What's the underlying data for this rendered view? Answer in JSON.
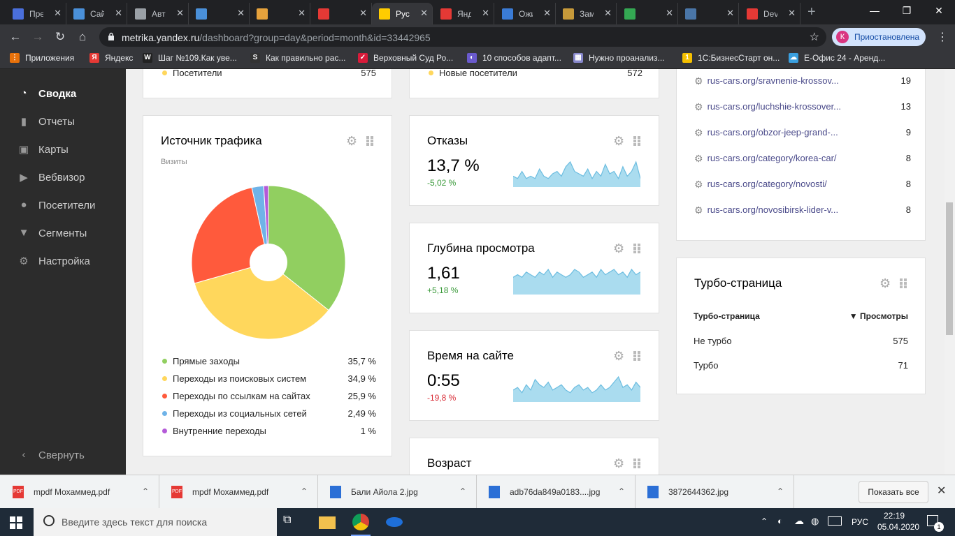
{
  "browser": {
    "tabs": [
      {
        "title": "Пре",
        "color": "#4a6fdc"
      },
      {
        "title": "Сай",
        "color": "#4a90d9"
      },
      {
        "title": "Авто",
        "color": "#9aa0a6"
      },
      {
        "title": "",
        "color": "#4a90d9"
      },
      {
        "title": "",
        "color": "#e6a23c"
      },
      {
        "title": "",
        "color": "#e53935"
      },
      {
        "title": "Рус",
        "color": "#ffcc00",
        "active": true
      },
      {
        "title": "Янд",
        "color": "#e53935"
      },
      {
        "title": "Ожи",
        "color": "#3a7bd5"
      },
      {
        "title": "Зам",
        "color": "#c79a3a"
      },
      {
        "title": "",
        "color": "#34a853"
      },
      {
        "title": "",
        "color": "#4a76a8"
      },
      {
        "title": "Dev",
        "color": "#e53935"
      }
    ],
    "url_host": "metrika.yandex.ru",
    "url_path": "/dashboard?group=day&period=month&id=33442965",
    "profile_initial": "К",
    "profile_label": "Приостановлена"
  },
  "bookmarks": [
    {
      "label": "Приложения",
      "icon": "apps-icon",
      "color": "#e8710a"
    },
    {
      "label": "Яндекс",
      "icon": "yandex-icon",
      "color": "#e53935"
    },
    {
      "label": "Шаг №109.Как уве...",
      "icon": "wp-icon",
      "color": "#222"
    },
    {
      "label": "Как правильно рас...",
      "icon": "s-icon",
      "color": "#333"
    },
    {
      "label": "Верховный Суд Ро...",
      "icon": "check-icon",
      "color": "#d81b3a"
    },
    {
      "label": "10 способов адапт...",
      "icon": "habr-icon",
      "color": "#6a5acd"
    },
    {
      "label": "Нужно проанализ...",
      "icon": "doc-icon",
      "color": "#8888cc"
    },
    {
      "label": "1С:БизнесСтарт он...",
      "icon": "1c-icon",
      "color": "#f5c000"
    },
    {
      "label": "Е-Офис 24 - Аренд...",
      "icon": "cloud-icon",
      "color": "#3aa0e0"
    }
  ],
  "sidebar": {
    "items": [
      {
        "label": "Сводка",
        "icon": "dashboard-icon"
      },
      {
        "label": "Отчеты",
        "icon": "bars-icon"
      },
      {
        "label": "Карты",
        "icon": "map-icon"
      },
      {
        "label": "Вебвизор",
        "icon": "play-icon"
      },
      {
        "label": "Посетители",
        "icon": "person-icon"
      },
      {
        "label": "Сегменты",
        "icon": "filter-icon"
      },
      {
        "label": "Настройка",
        "icon": "gear-icon"
      }
    ],
    "collapse_label": "Свернуть"
  },
  "top_partial": {
    "left_label": "Посетители",
    "left_value": "575",
    "mid_label": "Новые посетители",
    "mid_value": "572"
  },
  "traffic": {
    "title": "Источник трафика",
    "subtitle": "Визиты",
    "items": [
      {
        "label": "Прямые заходы",
        "value": "35,7 %",
        "color": "#91cf60"
      },
      {
        "label": "Переходы из поисковых систем",
        "value": "34,9 %",
        "color": "#ffd75c"
      },
      {
        "label": "Переходы по ссылкам на сайтах",
        "value": "25,9 %",
        "color": "#ff5a3c"
      },
      {
        "label": "Переходы из социальных сетей",
        "value": "2,49 %",
        "color": "#6fb3e8"
      },
      {
        "label": "Внутренние переходы",
        "value": "1 %",
        "color": "#b45ad8"
      }
    ],
    "shares": [
      35.7,
      34.9,
      25.9,
      2.49,
      1.0
    ]
  },
  "metrics": [
    {
      "title": "Отказы",
      "value": "13,7 %",
      "delta": "-5,02 %",
      "delta_color": "#3a9a3a",
      "series": [
        4,
        3,
        6,
        3,
        4,
        3,
        7,
        4,
        3,
        5,
        6,
        4,
        8,
        10,
        6,
        5,
        4,
        7,
        3,
        6,
        4,
        9,
        5,
        6,
        3,
        8,
        4,
        6,
        10,
        3
      ]
    },
    {
      "title": "Глубина просмотра",
      "value": "1,61",
      "delta": "+5,18 %",
      "delta_color": "#3a9a3a",
      "series": [
        6,
        7,
        6,
        8,
        7,
        6,
        8,
        7,
        9,
        6,
        8,
        7,
        6,
        7,
        9,
        8,
        6,
        7,
        8,
        6,
        9,
        7,
        8,
        9,
        7,
        8,
        6,
        9,
        7,
        8
      ]
    },
    {
      "title": "Время на сайте",
      "value": "0:55",
      "delta": "-19,8 %",
      "delta_color": "#d9303a",
      "series": [
        4,
        5,
        3,
        6,
        4,
        8,
        6,
        5,
        7,
        4,
        5,
        6,
        4,
        3,
        5,
        6,
        4,
        5,
        3,
        4,
        6,
        4,
        5,
        7,
        9,
        5,
        6,
        4,
        7,
        5
      ]
    },
    {
      "title": "Возраст"
    }
  ],
  "pages": [
    {
      "url": "rus-cars.org/sravnenie-krossov...",
      "count": "19"
    },
    {
      "url": "rus-cars.org/luchshie-krossover...",
      "count": "13"
    },
    {
      "url": "rus-cars.org/obzor-jeep-grand-...",
      "count": "9"
    },
    {
      "url": "rus-cars.org/category/korea-car/",
      "count": "8"
    },
    {
      "url": "rus-cars.org/category/novosti/",
      "count": "8"
    },
    {
      "url": "rus-cars.org/novosibirsk-lider-v...",
      "count": "8"
    }
  ],
  "turbo": {
    "title": "Турбо-страница",
    "col1": "Турбо-страница",
    "col2": "▼ Просмотры",
    "rows": [
      {
        "label": "Не турбо",
        "value": "575"
      },
      {
        "label": "Турбо",
        "value": "71"
      }
    ]
  },
  "downloads": {
    "items": [
      {
        "name": "mpdf Мохаммед.pdf",
        "type": "pdf"
      },
      {
        "name": "mpdf Мохаммед.pdf",
        "type": "pdf"
      },
      {
        "name": "Бали Айола 2.jpg",
        "type": "jpg"
      },
      {
        "name": "adb76da849a0183....jpg",
        "type": "jpg"
      },
      {
        "name": "3872644362.jpg",
        "type": "jpg"
      }
    ],
    "show_all": "Показать все"
  },
  "taskbar": {
    "search_placeholder": "Введите здесь текст для поиска",
    "lang": "РУС",
    "time": "22:19",
    "date": "05.04.2020",
    "notif_count": "1"
  }
}
